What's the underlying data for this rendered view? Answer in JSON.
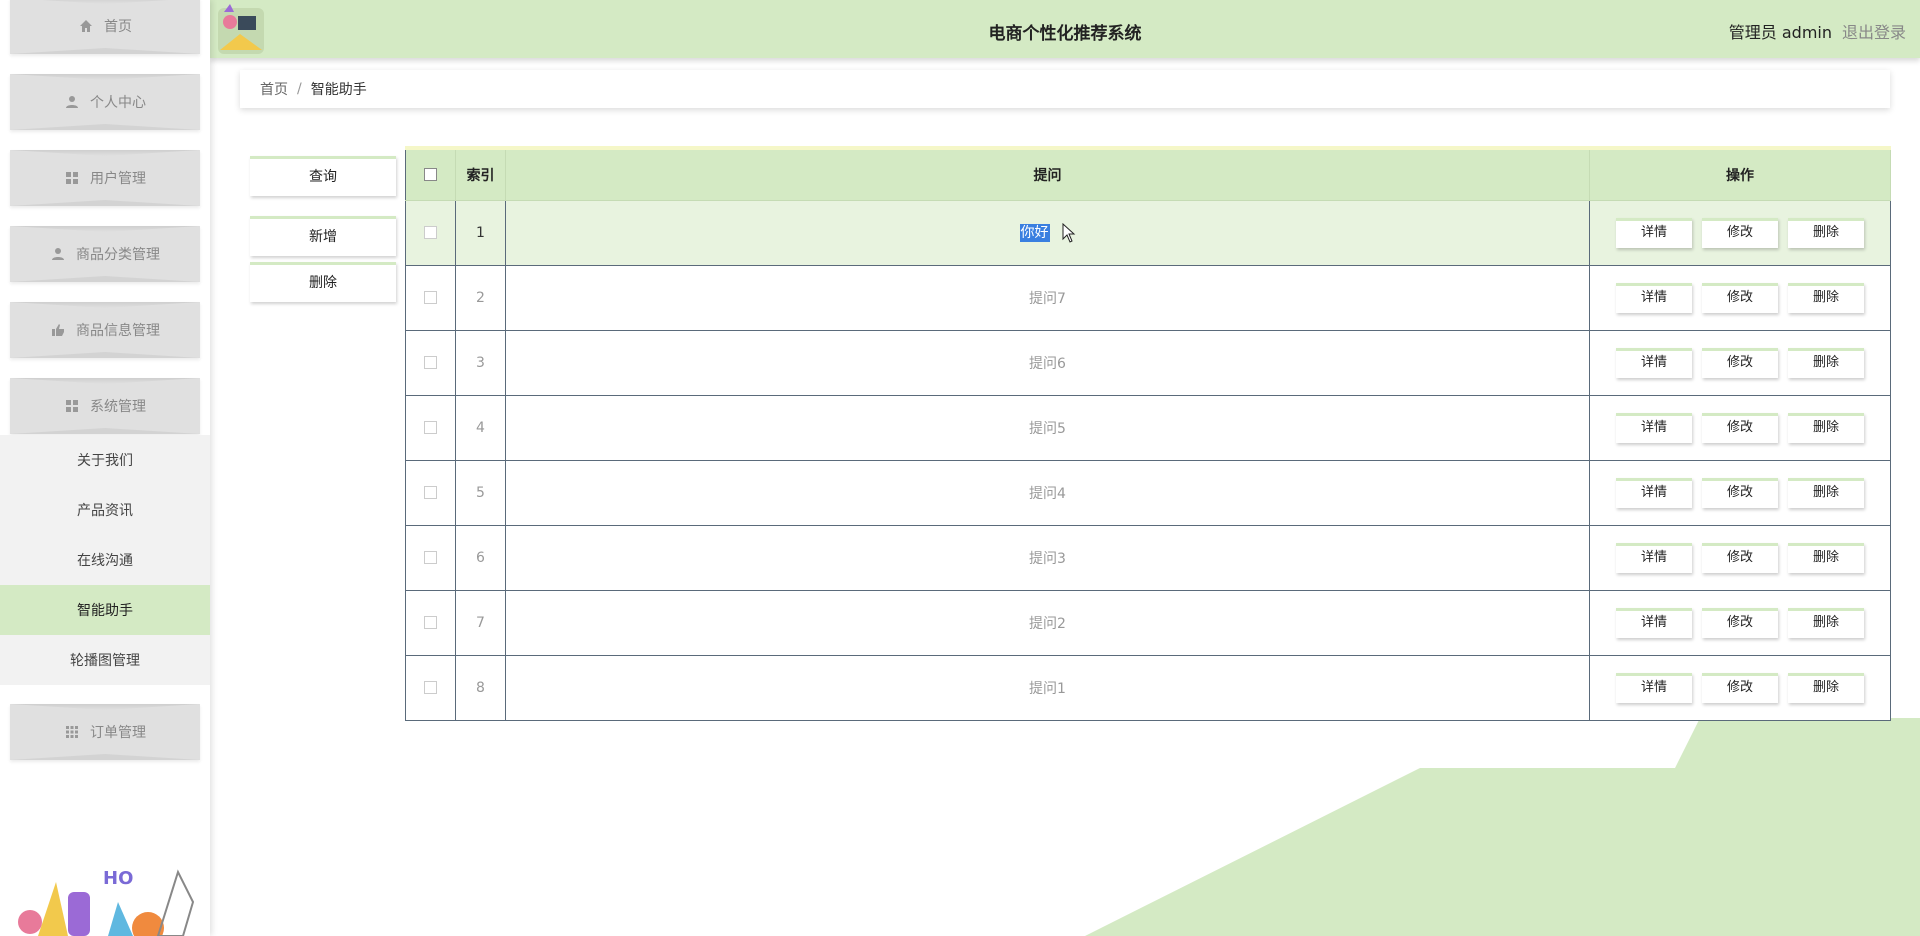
{
  "header": {
    "title": "电商个性化推荐系统",
    "user": "管理员 admin",
    "logout": "退出登录"
  },
  "sidebar": {
    "items": [
      {
        "label": "首页",
        "icon": "home-icon"
      },
      {
        "label": "个人中心",
        "icon": "user-icon"
      },
      {
        "label": "用户管理",
        "icon": "grid-icon"
      },
      {
        "label": "商品分类管理",
        "icon": "user-icon"
      },
      {
        "label": "商品信息管理",
        "icon": "thumb-icon"
      },
      {
        "label": "系统管理",
        "icon": "grid-icon"
      }
    ],
    "submenu": [
      {
        "label": "关于我们",
        "active": false
      },
      {
        "label": "产品资讯",
        "active": false
      },
      {
        "label": "在线沟通",
        "active": false
      },
      {
        "label": "智能助手",
        "active": true
      },
      {
        "label": "轮播图管理",
        "active": false
      }
    ],
    "last_item": {
      "label": "订单管理",
      "icon": "apps-icon"
    }
  },
  "breadcrumb": {
    "home": "首页",
    "separator": "/",
    "current": "智能助手"
  },
  "actions": {
    "query": "查询",
    "add": "新增",
    "delete": "删除"
  },
  "table": {
    "headers": {
      "index": "索引",
      "question": "提问",
      "operation": "操作"
    },
    "rows": [
      {
        "index": "1",
        "question": "你好",
        "selected": true
      },
      {
        "index": "2",
        "question": "提问7"
      },
      {
        "index": "3",
        "question": "提问6"
      },
      {
        "index": "4",
        "question": "提问5"
      },
      {
        "index": "5",
        "question": "提问4"
      },
      {
        "index": "6",
        "question": "提问3"
      },
      {
        "index": "7",
        "question": "提问2"
      },
      {
        "index": "8",
        "question": "提问1"
      }
    ],
    "row_buttons": {
      "detail": "详情",
      "edit": "修改",
      "delete": "删除"
    }
  },
  "colors": {
    "accent": "#d4eac4",
    "selection": "#3a7fe0"
  }
}
